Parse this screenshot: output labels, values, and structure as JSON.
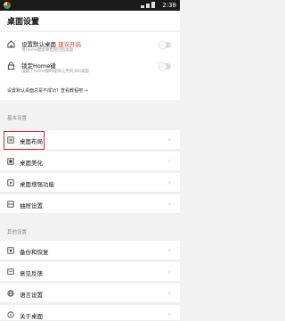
{
  "status_bar": {
    "time": "2:38"
  },
  "header": {
    "title": "桌面设置"
  },
  "default_launcher": {
    "title": "设置默认桌面",
    "recommend": "建议开启",
    "subtitle": "用Home键能够直接回到桌面"
  },
  "lock_home": {
    "title": "锁定Home键",
    "subtitle": "设置了Home键时能够让用到360桌面"
  },
  "hint": "设置默认桌面总是不成功？查看教程吧 →",
  "basic_section": {
    "label": "基本设置",
    "items": [
      {
        "label": "桌面布局",
        "icon": "layout-icon"
      },
      {
        "label": "桌面美化",
        "icon": "beautify-icon"
      },
      {
        "label": "桌面增强功能",
        "icon": "enhance-icon"
      },
      {
        "label": "抽屉设置",
        "icon": "drawer-icon"
      }
    ]
  },
  "other_section": {
    "label": "其他设置",
    "items": [
      {
        "label": "备份和恢复",
        "icon": "backup-icon"
      },
      {
        "label": "意见反馈",
        "icon": "feedback-icon"
      },
      {
        "label": "语言设置",
        "icon": "globe-icon"
      },
      {
        "label": "关于桌面",
        "icon": "info-icon"
      }
    ]
  },
  "colors": {
    "accent_red": "#e53935",
    "highlight_box": "#e02020"
  }
}
